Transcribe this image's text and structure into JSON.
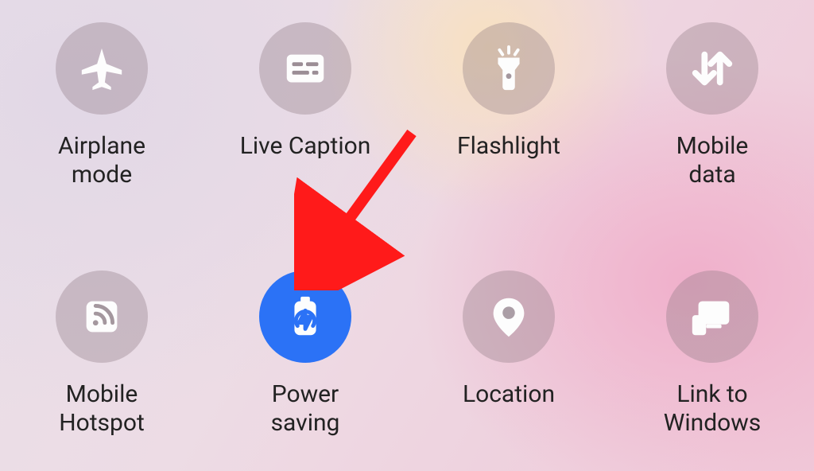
{
  "colors": {
    "active_tile_bg": "#2b72f6",
    "inactive_tile_bg": "rgba(140,120,130,0.35)",
    "icon_color": "#fdfdfd",
    "label_color": "#222222",
    "annotation_arrow": "#ff1a1a"
  },
  "tiles": [
    {
      "id": "airplane-mode",
      "label": "Airplane\nmode",
      "icon": "airplane-icon",
      "active": false
    },
    {
      "id": "live-caption",
      "label": "Live Caption",
      "icon": "closed-caption-icon",
      "active": false
    },
    {
      "id": "flashlight",
      "label": "Flashlight",
      "icon": "flashlight-icon",
      "active": false
    },
    {
      "id": "mobile-data",
      "label": "Mobile\ndata",
      "icon": "mobile-data-icon",
      "active": false
    },
    {
      "id": "mobile-hotspot",
      "label": "Mobile\nHotspot",
      "icon": "hotspot-icon",
      "active": false
    },
    {
      "id": "power-saving",
      "label": "Power\nsaving",
      "icon": "battery-saver-icon",
      "active": true
    },
    {
      "id": "location",
      "label": "Location",
      "icon": "location-pin-icon",
      "active": false
    },
    {
      "id": "link-to-windows",
      "label": "Link to\nWindows",
      "icon": "link-to-windows-icon",
      "active": false
    }
  ],
  "annotation": {
    "points_to": "power-saving",
    "description": "Red arrow pointing at the Power saving toggle"
  }
}
